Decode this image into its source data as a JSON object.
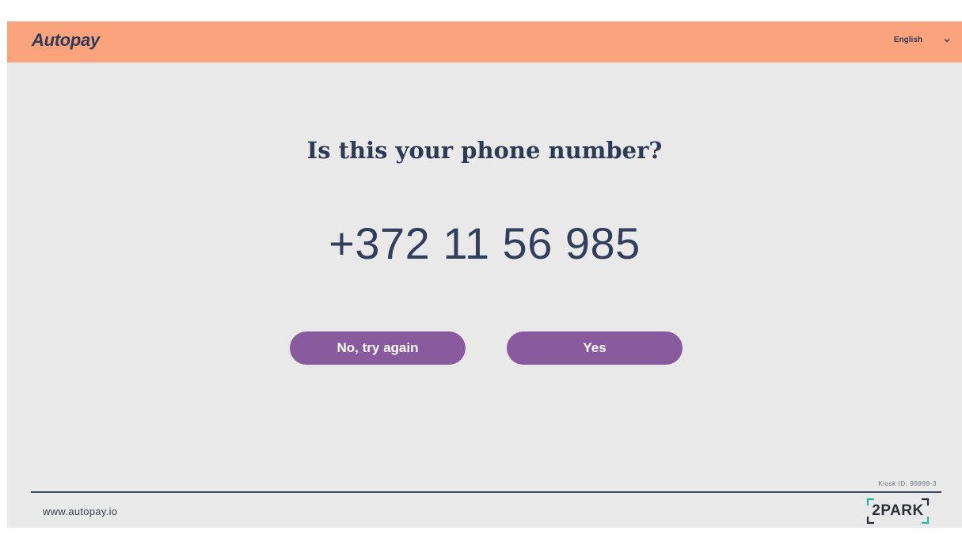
{
  "header": {
    "logo": "Autopay",
    "language": "English",
    "language_icon": "chevron-down-icon"
  },
  "main": {
    "title": "Is this your phone number?",
    "phone_number": "+372 11 56 985",
    "no_button_label": "No, try again",
    "yes_button_label": "Yes"
  },
  "footer": {
    "kiosk_id": "Kiosk ID: 99999-3",
    "website": "www.autopay.io",
    "partner_logo": "2PARK"
  },
  "colors": {
    "header_bg": "#fba37d",
    "page_bg": "#e9e9e9",
    "text_primary": "#2f3a55",
    "button_bg": "#8a5a9e",
    "brand_accent": "#2bb3a3"
  }
}
